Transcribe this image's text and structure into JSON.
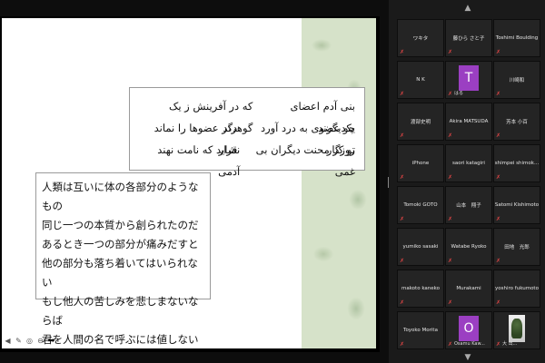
{
  "slide": {
    "persian_lines": [
      {
        "right": "بنی آدم اعضای یکدیگرند",
        "left": "که در آفرینش ز یک گوهرند"
      },
      {
        "right": "چو عضوی به درد آورد روزگار",
        "left": "دگر عضوها را نماند قرار"
      },
      {
        "right": "تو کز محنت دیگران بی غمی",
        "left": "نشاید که نامت نهند آدمی"
      }
    ],
    "japanese_lines": [
      "人類は互いに体の各部分のようなもの",
      "同じ一つの本質から創られたのだ",
      "あるとき一つの部分が痛みだすと",
      "他の部分も落ち着いてはいられない",
      "もし他人の苦しみを悲しまないならば",
      "君を人間の名で呼ぶには値しない"
    ]
  },
  "tools": [
    "left-arrow-icon",
    "pen-icon",
    "circle-icon",
    "minus-icon",
    "right-arrow-icon"
  ],
  "gallery": {
    "tiles": [
      {
        "name": "ワキタ",
        "muted": true
      },
      {
        "name": "藤ひら さと子",
        "muted": true
      },
      {
        "name": "Toshimi Boulding",
        "muted": true
      },
      {
        "name": "N K",
        "muted": true
      },
      {
        "name": "",
        "avatar": "T",
        "sub": "はる",
        "muted": true
      },
      {
        "name": "川崎和",
        "muted": true
      },
      {
        "name": "渡部史明",
        "muted": true
      },
      {
        "name": "Akira MATSUDA",
        "muted": true
      },
      {
        "name": "芳本 小百",
        "muted": true
      },
      {
        "name": "iPhone",
        "muted": true
      },
      {
        "name": "saori katagiri",
        "muted": true
      },
      {
        "name": "shimpei shimok...",
        "muted": true
      },
      {
        "name": "Tomoki GOTO",
        "muted": true
      },
      {
        "name": "山本　翔子",
        "muted": true
      },
      {
        "name": "Satomi Kishimoto",
        "muted": true
      },
      {
        "name": "yumiko sasaki",
        "muted": true
      },
      {
        "name": "Watabe Ryoko",
        "muted": true
      },
      {
        "name": "田地　光郎",
        "muted": true
      },
      {
        "name": "makoto kaneko",
        "muted": true
      },
      {
        "name": "Murakami",
        "muted": true
      },
      {
        "name": "yoshiro fukumoto",
        "muted": true
      },
      {
        "name": "Toyoko Morita",
        "muted": true
      },
      {
        "name": "",
        "avatar": "O",
        "sub": "Osamu Kaw...",
        "muted": true
      },
      {
        "name": "",
        "photo": true,
        "sub": "大 出...",
        "muted": true
      }
    ]
  },
  "colors": {
    "avatar_purple": "#9b3fc2",
    "mute_red": "#e04545",
    "panel_bg": "#1a1a1a",
    "pattern_green": "#d6e2c9"
  }
}
